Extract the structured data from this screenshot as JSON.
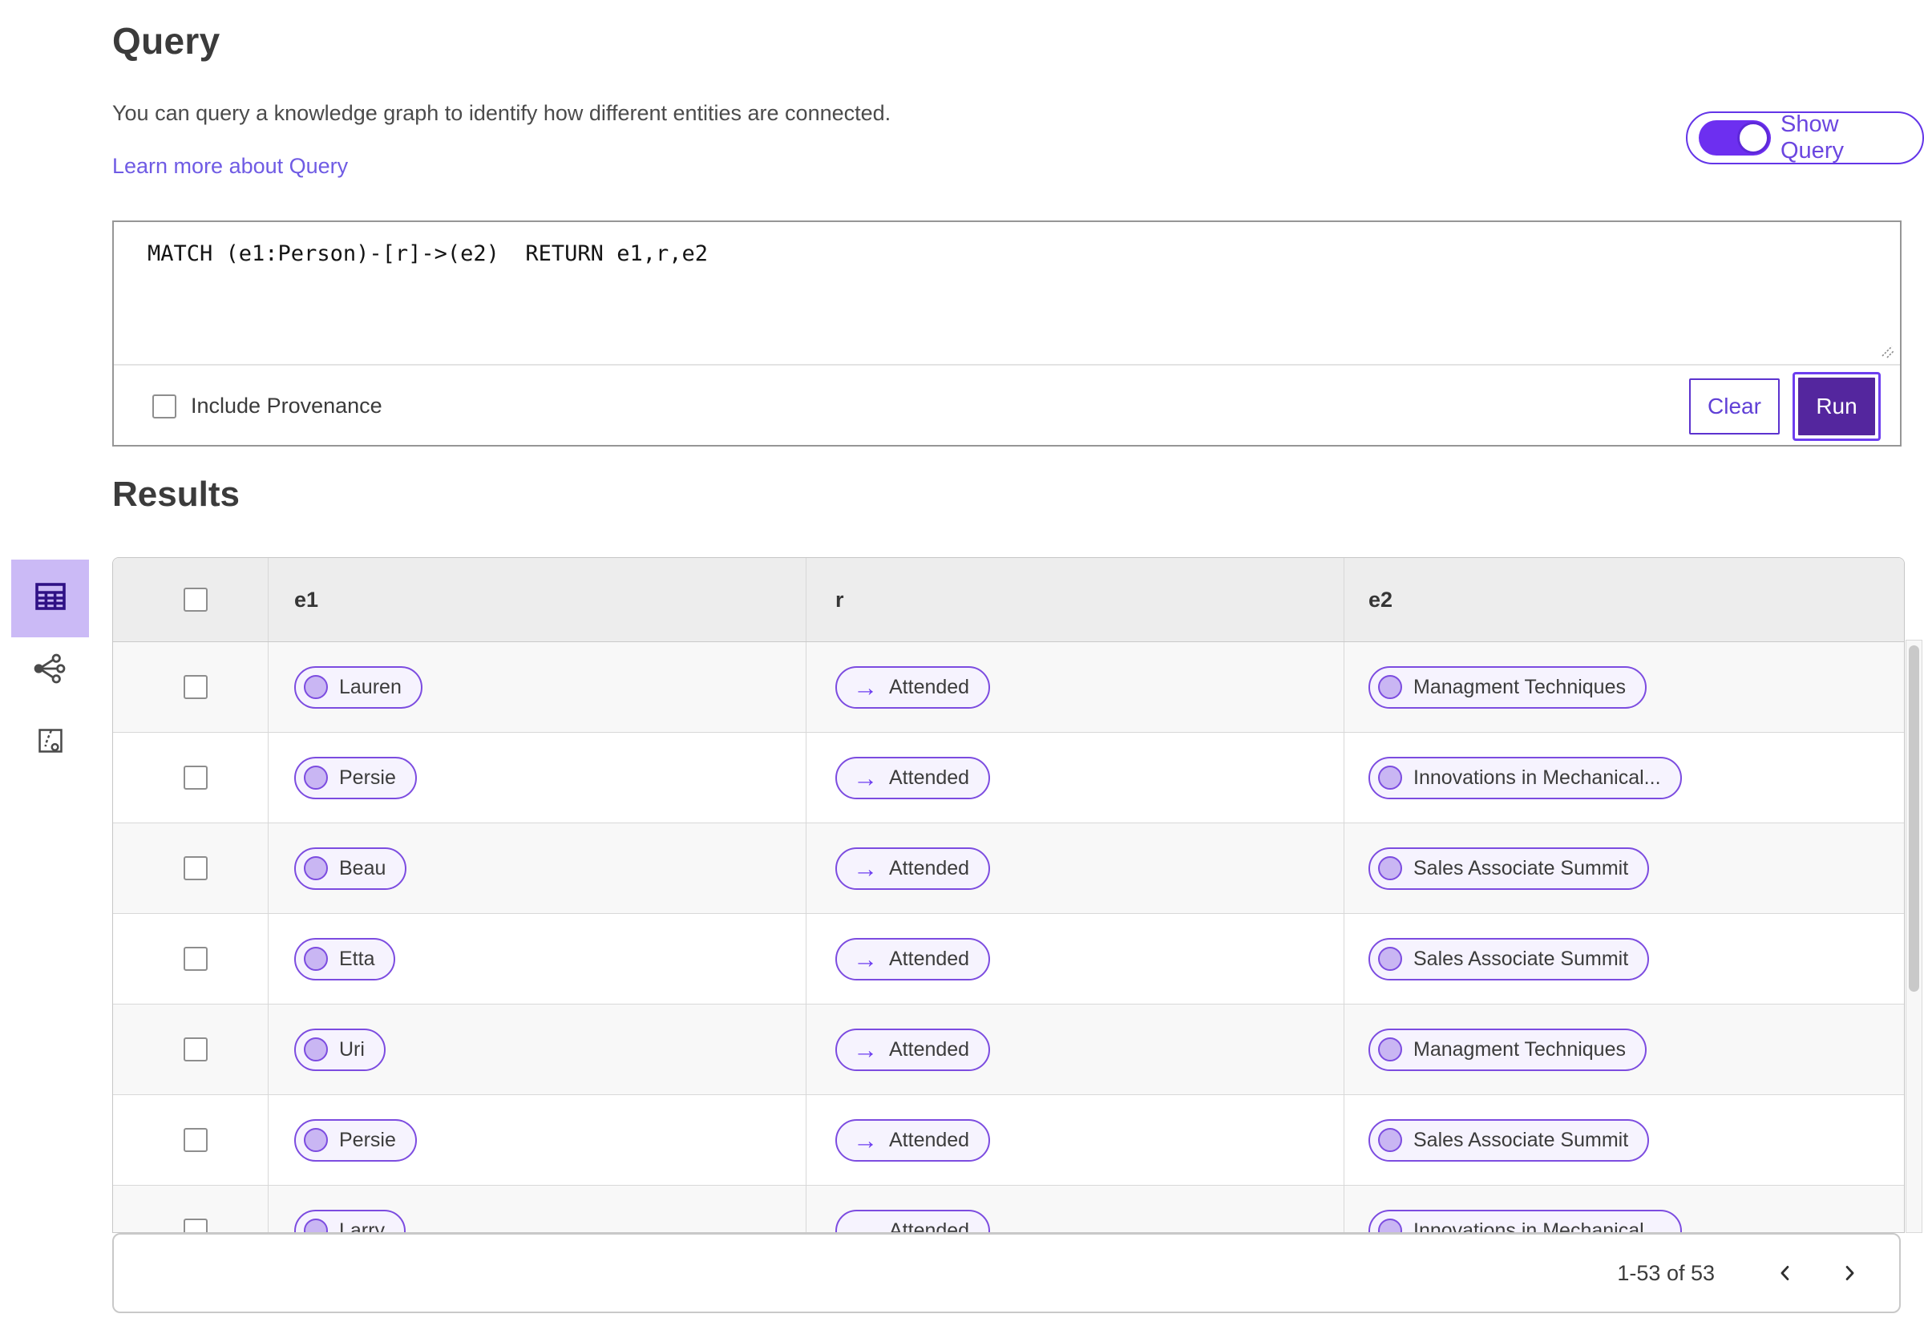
{
  "colors": {
    "accent_purple": "#6B3DF0",
    "deep_purple": "#54269E",
    "pill_border": "#7C4CE0",
    "pill_background": "#F6F3FE",
    "pill_dot": "#C9B6F3",
    "selected_view_background": "#CBBAF6",
    "table_header_background": "#EDEDED",
    "row_alternate_background": "#F8F8F8",
    "link_color": "#6F5BE4"
  },
  "query_section": {
    "title": "Query",
    "description": "You can query a knowledge graph to identify how different entities are connected.",
    "learn_more_label": "Learn more about Query",
    "show_query_toggle": {
      "label": "Show Query",
      "state": "on"
    },
    "query_text": "MATCH (e1:Person)-[r]->(e2)  RETURN e1,r,e2",
    "include_provenance": {
      "label": "Include Provenance",
      "checked": false
    },
    "clear_label": "Clear",
    "run_label": "Run"
  },
  "results_section": {
    "title": "Results",
    "view_switcher": [
      {
        "icon": "table-view-icon",
        "selected": true
      },
      {
        "icon": "graph-view-icon",
        "selected": false
      },
      {
        "icon": "path-view-icon",
        "selected": false
      }
    ],
    "table": {
      "columns": [
        "e1",
        "r",
        "e2"
      ],
      "relation_arrow": "→",
      "rows": [
        {
          "e1": "Lauren",
          "r": "Attended",
          "e2": "Managment Techniques"
        },
        {
          "e1": "Persie",
          "r": "Attended",
          "e2": "Innovations in Mechanical..."
        },
        {
          "e1": "Beau",
          "r": "Attended",
          "e2": "Sales Associate Summit"
        },
        {
          "e1": "Etta",
          "r": "Attended",
          "e2": "Sales Associate Summit"
        },
        {
          "e1": "Uri",
          "r": "Attended",
          "e2": "Managment Techniques"
        },
        {
          "e1": "Persie",
          "r": "Attended",
          "e2": "Sales Associate Summit"
        },
        {
          "e1": "Larry",
          "r": "Attended",
          "e2": "Innovations in Mechanical..."
        }
      ]
    },
    "pagination": {
      "range_label": "1-53 of 53"
    }
  }
}
